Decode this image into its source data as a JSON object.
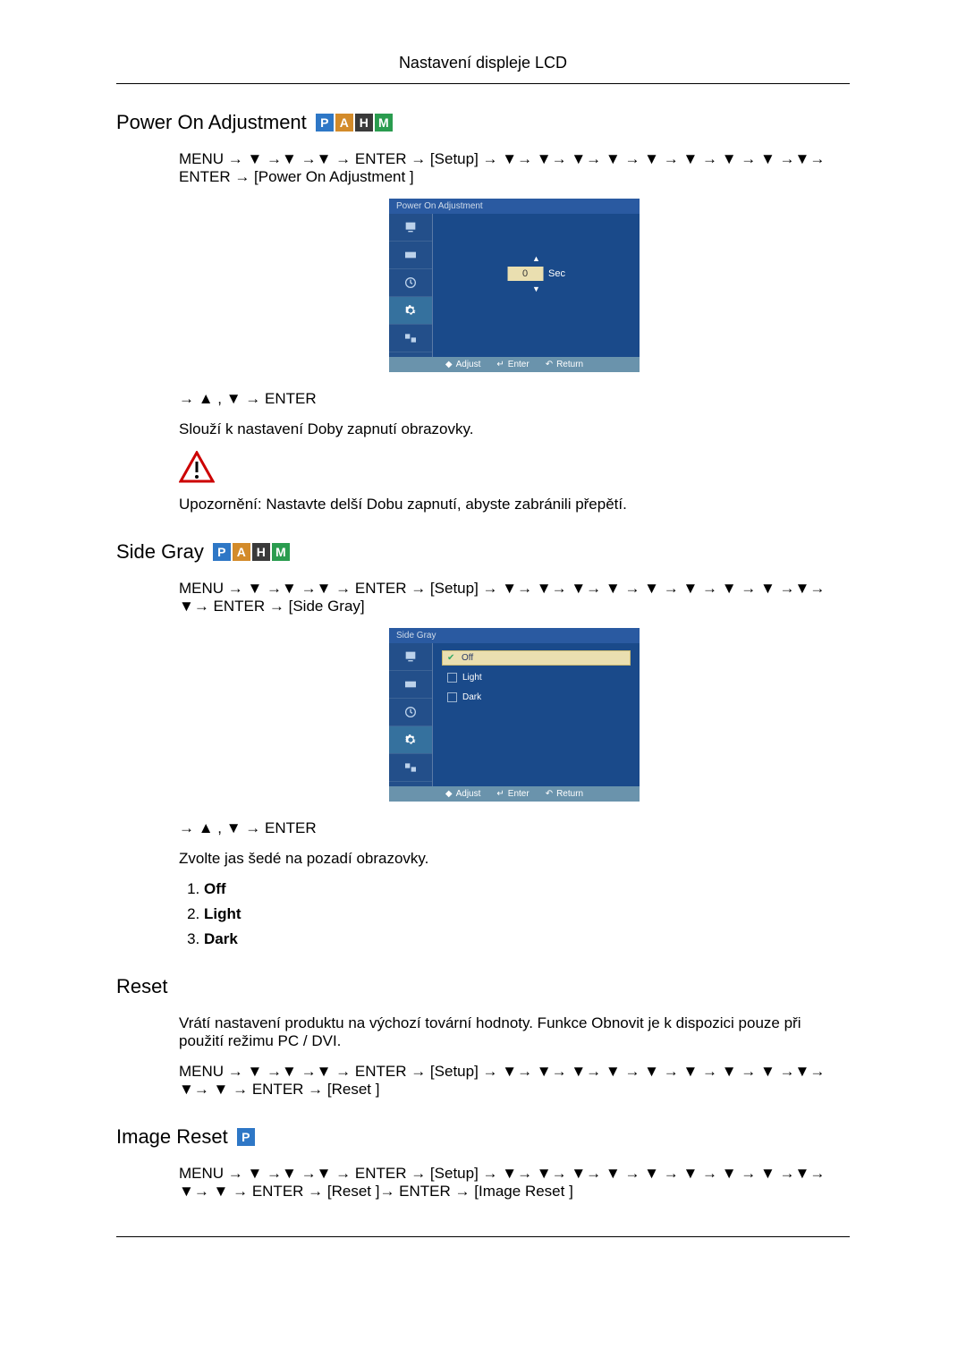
{
  "page_header": "Nastavení displeje LCD",
  "arrows": {
    "up": "▲",
    "down": "▼",
    "right": "→"
  },
  "s1": {
    "title": "Power On Adjustment",
    "badges": [
      "P",
      "A",
      "H",
      "M"
    ],
    "path_line1": "MENU → ▼ →▼ →▼ → ENTER → [Setup] → ▼→ ▼→ ▼→ ▼ → ▼ → ▼ → ▼ → ▼ →▼→ ENTER → [Power On Adjustment ]",
    "osd": {
      "title": "Power On Adjustment",
      "value": "0",
      "unit": "Sec",
      "footer": {
        "adjust": "Adjust",
        "enter": "Enter",
        "return": "Return"
      }
    },
    "after_osd": "→ ▲ , ▼ → ENTER",
    "desc": "Slouží k nastavení Doby zapnutí obrazovky.",
    "warn": "Upozornění: Nastavte delší Dobu zapnutí, abyste zabránili přepětí."
  },
  "s2": {
    "title": "Side Gray",
    "badges": [
      "P",
      "A",
      "H",
      "M"
    ],
    "path_line1": "MENU → ▼ →▼ →▼ → ENTER → [Setup] → ▼→ ▼→ ▼→ ▼ → ▼ → ▼ → ▼ → ▼ →▼→ ▼→ ENTER → [Side Gray]",
    "osd": {
      "title": "Side Gray",
      "options": [
        "Off",
        "Light",
        "Dark"
      ],
      "selected": 0,
      "footer": {
        "adjust": "Adjust",
        "enter": "Enter",
        "return": "Return"
      }
    },
    "after_osd": "→ ▲ , ▼ → ENTER",
    "desc": "Zvolte jas šedé na pozadí obrazovky.",
    "options": [
      "Off",
      "Light",
      "Dark"
    ]
  },
  "s3": {
    "title": "Reset",
    "desc": "Vrátí nastavení produktu na výchozí tovární hodnoty. Funkce Obnovit je k dispozici pouze při použití režimu PC / DVI.",
    "path": "MENU → ▼ →▼ →▼ → ENTER → [Setup] → ▼→ ▼→ ▼→ ▼ → ▼ → ▼ → ▼ → ▼ →▼→ ▼→ ▼ → ENTER → [Reset ]"
  },
  "s4": {
    "title": "Image Reset",
    "badges": [
      "P"
    ],
    "path": "MENU → ▼ →▼ →▼ → ENTER → [Setup] → ▼→ ▼→ ▼→ ▼ → ▼ → ▼ → ▼ → ▼ →▼→ ▼→ ▼ → ENTER → [Reset ]→ ENTER → [Image Reset ]"
  }
}
